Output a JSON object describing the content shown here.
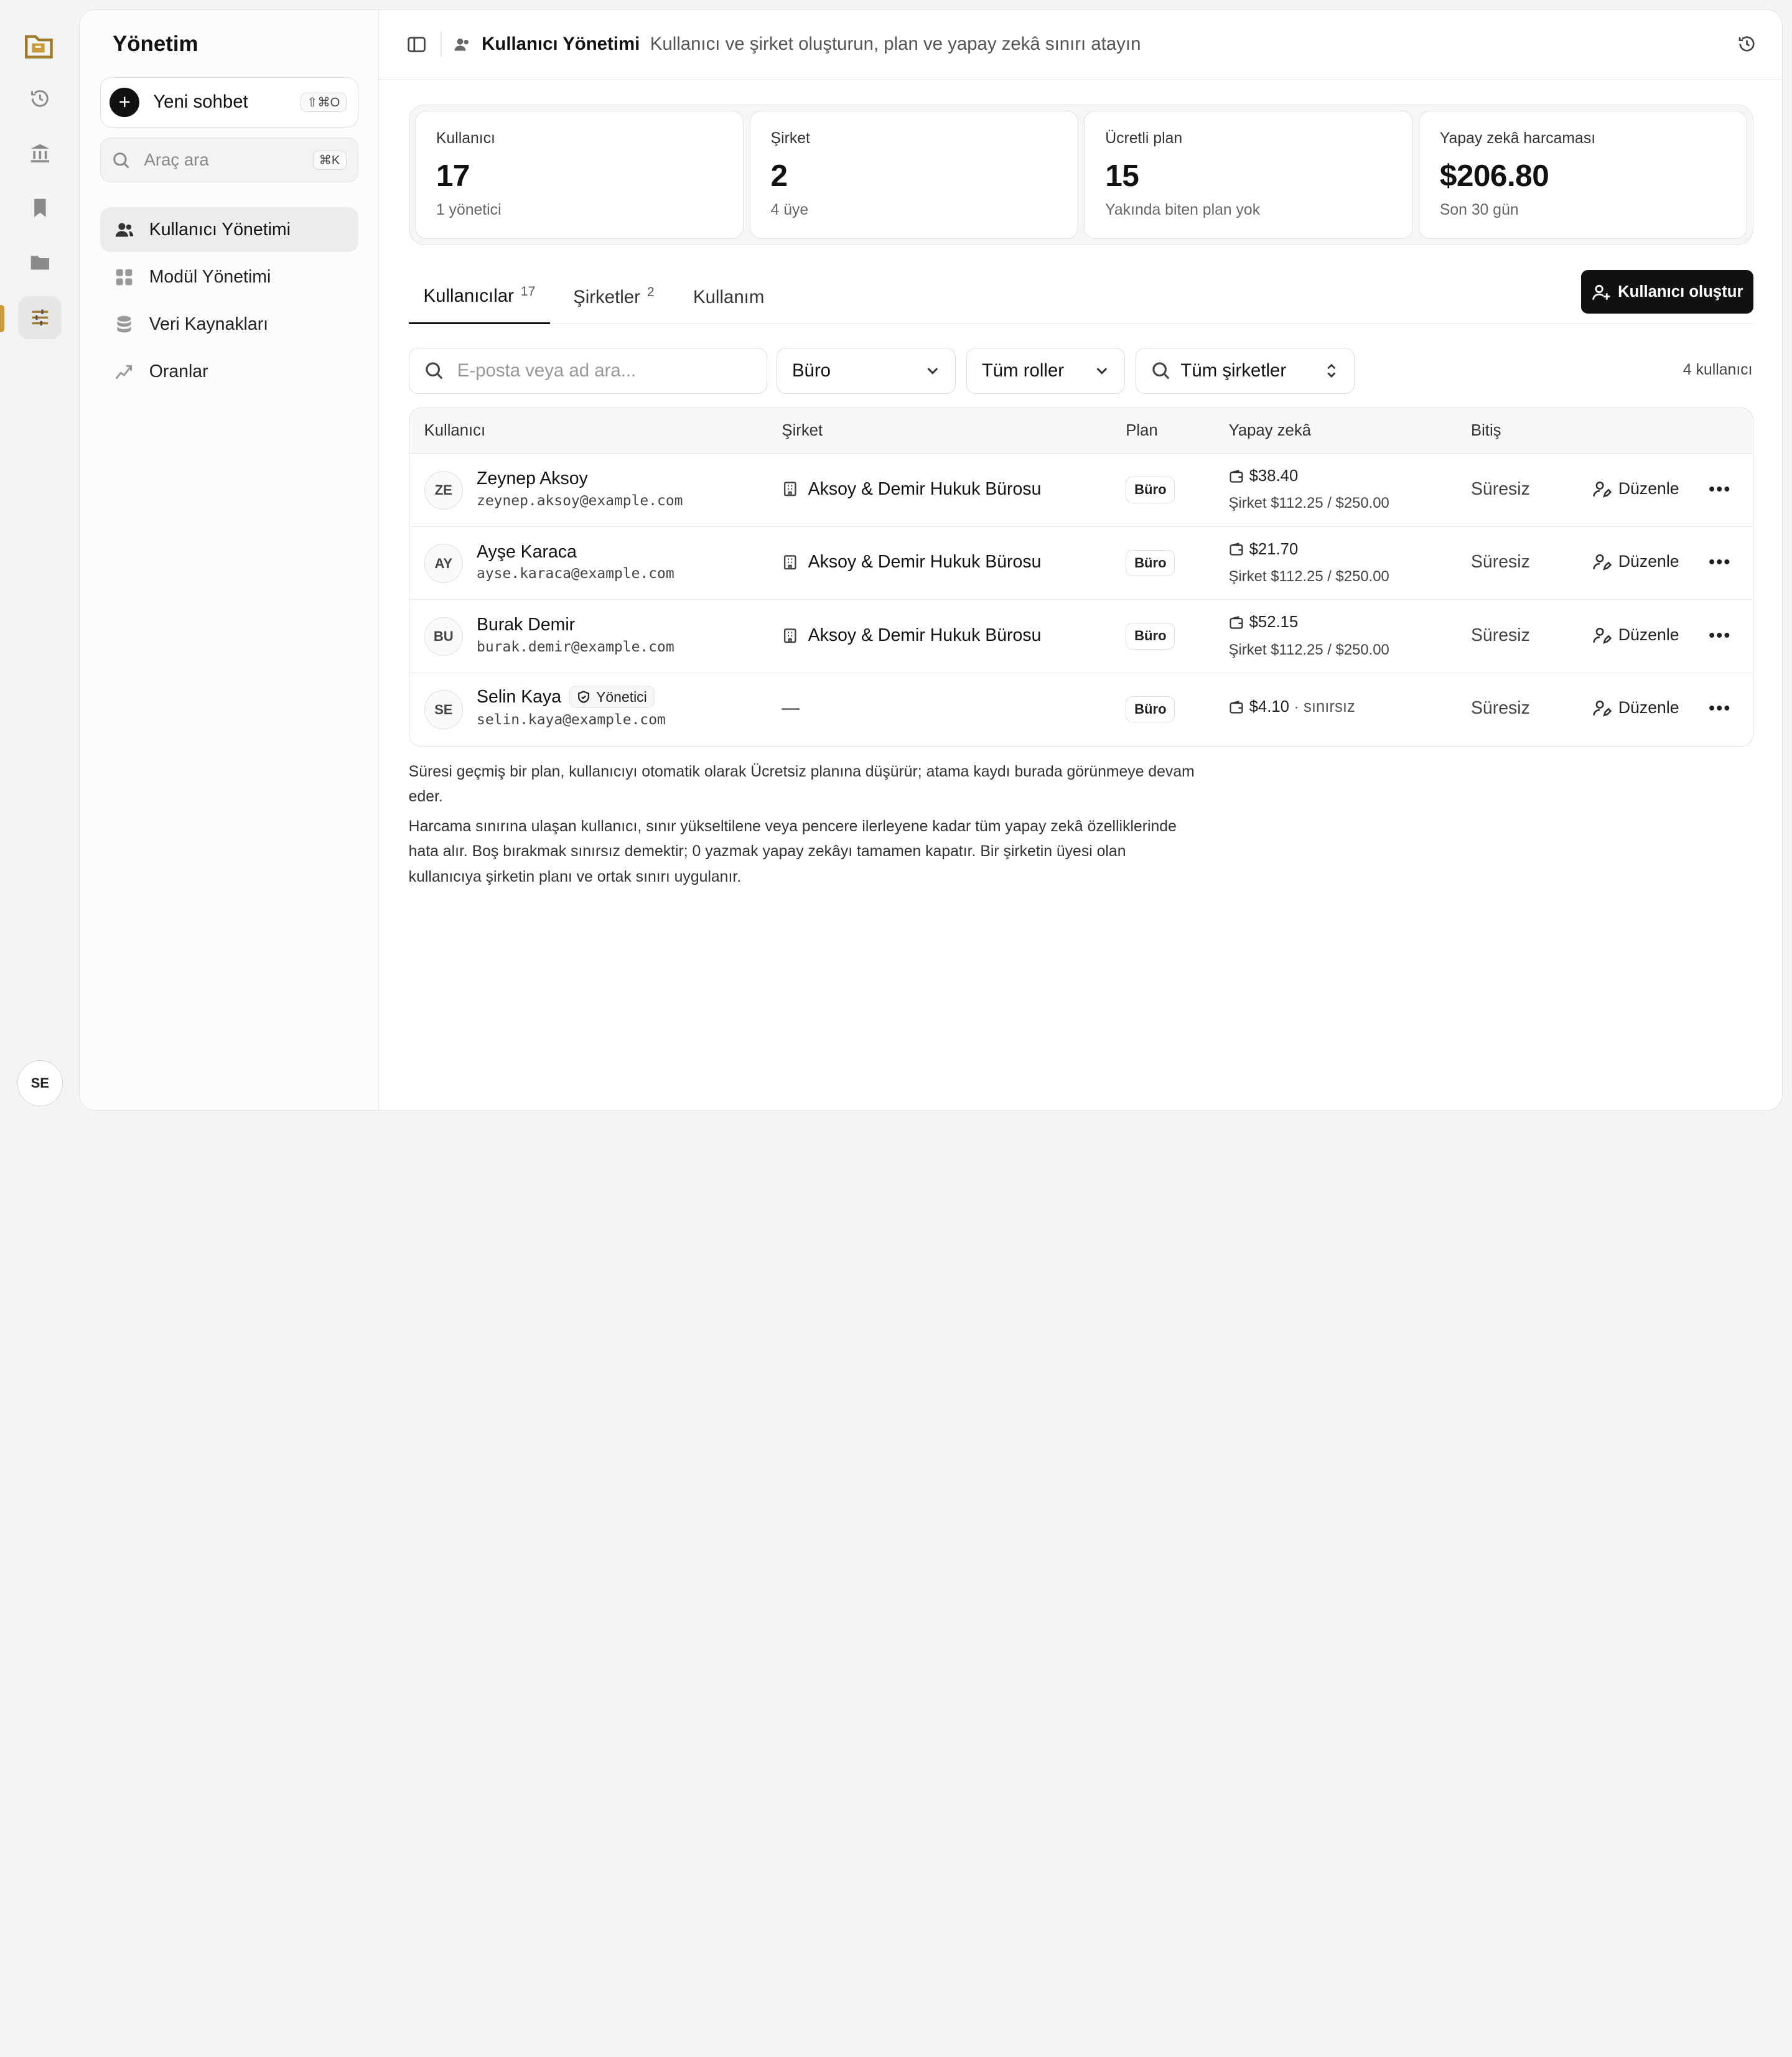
{
  "rail": {
    "avatar_initials": "SE",
    "items": [
      "history-icon",
      "institution-icon",
      "bookmark-icon",
      "folder-icon",
      "sliders-icon"
    ],
    "accent": "#c89b3c"
  },
  "sidebar": {
    "title": "Yönetim",
    "new_chat": {
      "label": "Yeni sohbet",
      "shortcut": "⇧⌘O"
    },
    "tool_search": {
      "placeholder": "Araç ara",
      "shortcut": "⌘K"
    },
    "items": [
      {
        "label": "Kullanıcı Yönetimi",
        "icon": "users-icon",
        "active": true
      },
      {
        "label": "Modül Yönetimi",
        "icon": "grid-icon"
      },
      {
        "label": "Veri Kaynakları",
        "icon": "database-icon"
      },
      {
        "label": "Oranlar",
        "icon": "trend-icon"
      }
    ]
  },
  "header": {
    "title": "Kullanıcı Yönetimi",
    "subtitle": "Kullanıcı ve şirket oluşturun, plan ve yapay zekâ sınırı atayın"
  },
  "stats": [
    {
      "label": "Kullanıcı",
      "value": "17",
      "sub": "1 yönetici"
    },
    {
      "label": "Şirket",
      "value": "2",
      "sub": "4 üye"
    },
    {
      "label": "Ücretli plan",
      "value": "15",
      "sub": "Yakında biten plan yok"
    },
    {
      "label": "Yapay zekâ harcaması",
      "value": "$206.80",
      "sub": "Son 30 gün"
    }
  ],
  "tabs": [
    {
      "label": "Kullanıcılar",
      "count": "17",
      "active": true
    },
    {
      "label": "Şirketler",
      "count": "2"
    },
    {
      "label": "Kullanım",
      "count": ""
    }
  ],
  "create_button": "Kullanıcı oluştur",
  "filters": {
    "search_placeholder": "E-posta veya ad ara...",
    "plan": "Büro",
    "roles": "Tüm roller",
    "companies": "Tüm şirketler",
    "result_count": "4 kullanıcı"
  },
  "table": {
    "headers": [
      "Kullanıcı",
      "Şirket",
      "Plan",
      "Yapay zekâ",
      "Bitiş"
    ],
    "edit_label": "Düzenle",
    "rows": [
      {
        "initials": "ZE",
        "name": "Zeynep Aksoy",
        "email": "zeynep.aksoy@example.com",
        "company": "Aksoy & Demir Hukuk Bürosu",
        "plan": "Büro",
        "ai": "$38.40",
        "ai_sub": "Şirket $112.25 / $250.00",
        "expiry": "Süresiz"
      },
      {
        "initials": "AY",
        "name": "Ayşe Karaca",
        "email": "ayse.karaca@example.com",
        "company": "Aksoy & Demir Hukuk Bürosu",
        "plan": "Büro",
        "ai": "$21.70",
        "ai_sub": "Şirket $112.25 / $250.00",
        "expiry": "Süresiz"
      },
      {
        "initials": "BU",
        "name": "Burak Demir",
        "email": "burak.demir@example.com",
        "company": "Aksoy & Demir Hukuk Bürosu",
        "plan": "Büro",
        "ai": "$52.15",
        "ai_sub": "Şirket $112.25 / $250.00",
        "expiry": "Süresiz"
      },
      {
        "initials": "SE",
        "name": "Selin Kaya",
        "role": "Yönetici",
        "email": "selin.kaya@example.com",
        "company": "—",
        "plan": "Büro",
        "ai": "$4.10",
        "ai_note": "· sınırsız",
        "expiry": "Süresiz"
      }
    ]
  },
  "notes": [
    "Süresi geçmiş bir plan, kullanıcıyı otomatik olarak Ücretsiz planına düşürür; atama kaydı burada görünmeye devam eder.",
    "Harcama sınırına ulaşan kullanıcı, sınır yükseltilene veya pencere ilerleyene kadar tüm yapay zekâ özelliklerinde hata alır. Boş bırakmak sınırsız demektir; 0 yazmak yapay zekâyı tamamen kapatır. Bir şirketin üyesi olan kullanıcıya şirketin planı ve ortak sınırı uygulanır."
  ]
}
